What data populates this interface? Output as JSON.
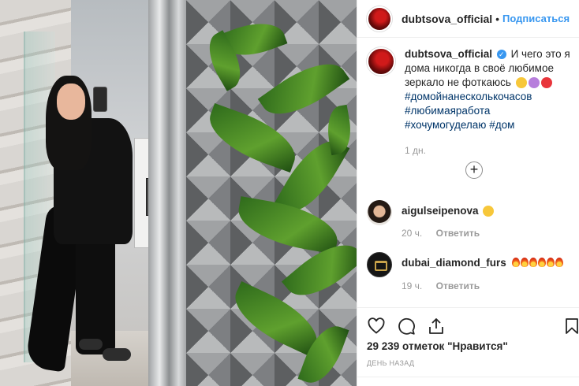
{
  "post": {
    "username": "dubtsova_official",
    "follow_label": "Подписаться",
    "header_separator": "•",
    "verified_mark": "✓",
    "caption_text": "И чего это я дома никогда в своё любимое зеркало не фоткаюсь",
    "hashtags": [
      "#домойнанесколькочасов",
      "#любимаяработа",
      "#хочумогуделаю",
      "#дом"
    ],
    "caption_time": "1 дн.",
    "load_more_symbol": "+",
    "likes": "29 239 отметок \"Нравится\"",
    "posted_ago": "ДЕНЬ НАЗАД"
  },
  "comments": [
    {
      "username": "aigulseipenova",
      "time": "20 ч.",
      "reply_label": "Ответить"
    },
    {
      "username": "dubai_diamond_furs",
      "time": "19 ч.",
      "reply_label": "Ответить"
    }
  ],
  "icons": {
    "like": "heart-icon",
    "comment": "comment-icon",
    "share": "share-icon",
    "save": "bookmark-icon"
  },
  "colors": {
    "link_blue": "#3897f0",
    "hashtag": "#003569",
    "muted": "#999999"
  }
}
